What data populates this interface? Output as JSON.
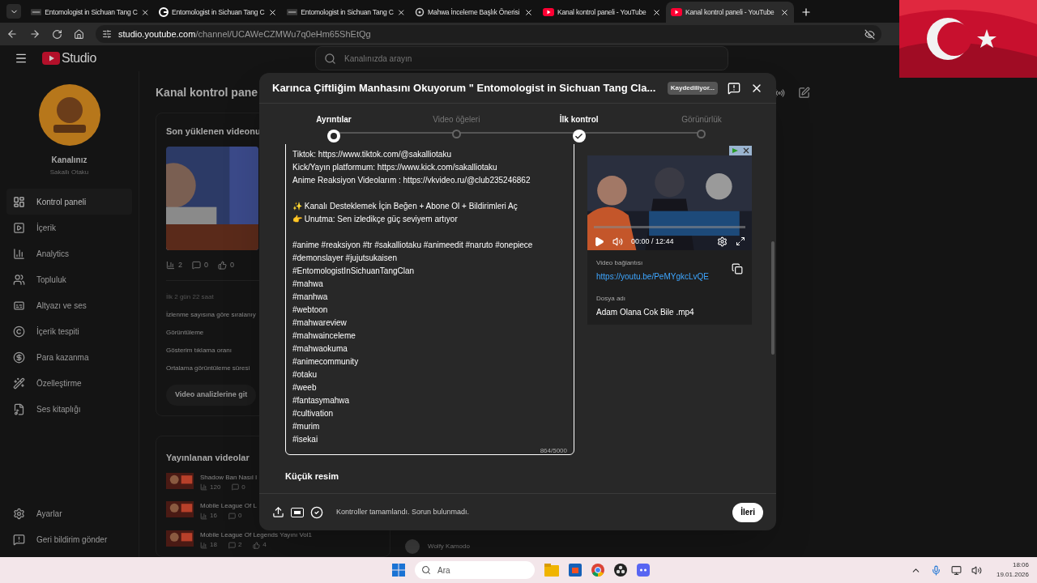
{
  "browser": {
    "tabs": [
      {
        "kind": "mgt",
        "title": "Entomologist in Sichuan Tang C",
        "selected": false
      },
      {
        "kind": "google",
        "title": "Entomologist in Sichuan Tang C",
        "selected": false
      },
      {
        "kind": "mgt",
        "title": "Entomologist in Sichuan Tang C",
        "selected": false
      },
      {
        "kind": "chat",
        "title": "Mahwa İnceleme Başlık Önerisi",
        "selected": false
      },
      {
        "kind": "youtube",
        "title": "Kanal kontrol paneli - YouTube",
        "selected": false
      },
      {
        "kind": "youtube",
        "title": "Kanal kontrol paneli - YouTube",
        "selected": true
      }
    ],
    "url_host": "studio.youtube.com",
    "url_path": "/channel/UCAWeCZMWu7q0eHm65ShEtQg"
  },
  "studio": {
    "logo": "Studio",
    "search_placeholder": "Kanalınızda arayın",
    "channel": {
      "label": "Kanalınız",
      "name": "Sakallı Otaku"
    },
    "nav": [
      {
        "kind": "dashboard",
        "label": "Kontrol paneli",
        "selected": true
      },
      {
        "kind": "content",
        "label": "İçerik",
        "selected": false
      },
      {
        "kind": "analytics",
        "label": "Analytics",
        "selected": false
      },
      {
        "kind": "community",
        "label": "Topluluk",
        "selected": false
      },
      {
        "kind": "subtitles",
        "label": "Altyazı ve ses",
        "selected": false
      },
      {
        "kind": "copyright",
        "label": "İçerik tespiti",
        "selected": false
      },
      {
        "kind": "earn",
        "label": "Para kazanma",
        "selected": false
      },
      {
        "kind": "customize",
        "label": "Özelleştirme",
        "selected": false
      },
      {
        "kind": "audio",
        "label": "Ses kitaplığı",
        "selected": false
      }
    ],
    "nav_bottom": [
      {
        "kind": "settings",
        "label": "Ayarlar",
        "selected": false
      },
      {
        "kind": "feedback",
        "label": "Geri bildirim gönder",
        "selected": false
      }
    ],
    "page_title": "Kanal kontrol pane",
    "latest": {
      "title": "Son yüklenen videonu",
      "stats": [
        "2",
        "0",
        "0"
      ],
      "period": "İlk 2 gün 22 saat",
      "rows": [
        "İzlenme sayısına göre sıralanıy",
        "Görüntüleme",
        "Gösterim tıklama oranı",
        "Ortalama görüntüleme süresi"
      ],
      "button": "Video analizlerine git"
    },
    "published": {
      "title": "Yayınlanan videolar",
      "videos": [
        {
          "title": "Shadow Ban Nasıl I",
          "views": "120",
          "comments": "0"
        },
        {
          "title": "Mobile League Of L",
          "views": "16",
          "comments": "0"
        },
        {
          "title": "Mobile League Of Legends Yayını Vol1",
          "views": "18",
          "comments": "2",
          "likes": "4"
        }
      ]
    },
    "comment_author": "Wolfy Kamodo"
  },
  "dialog": {
    "title": "Karınca Çiftliğim Manhasını Okuyorum \" Entomologist in Sichuan Tang Cla...",
    "saving": "Kaydediliyor...",
    "steps": [
      {
        "label": "Ayrıntılar",
        "kind": "current"
      },
      {
        "label": "Video öğeleri",
        "kind": "pending"
      },
      {
        "label": "İlk kontrol",
        "kind": "done"
      },
      {
        "label": "Görünürlük",
        "kind": "pending"
      }
    ],
    "description": [
      [
        "Tiktok: https://www.tiktok.com/@sakalliotaku",
        "Kick/Yayın platformum: https://www.kick.com/sakalliotaku",
        "Anime Reaksiyon Videolarım : https://vkvideo.ru/@club235246862"
      ],
      [
        "✨ Kanalı Desteklemek İçin Beğen + Abone Ol + Bildirimleri Aç",
        "👉 Unutma: Sen izledikçe güç seviyem artıyor"
      ],
      [
        "#anime #reaksiyon #tr #sakalliotaku #animeedit #naruto #onepiece",
        "#demonslayer #jujutsukaisen",
        "#EntomologistInSichuanTangClan",
        "#mahwa",
        "#manhwa",
        "#webtoon",
        "#mahwareview",
        "#mahwainceleme",
        "#mahwaokuma",
        "#animecommunity",
        "#otaku",
        "#weeb",
        "#fantasymahwa",
        "#cultivation",
        "#murim",
        "#isekai"
      ]
    ],
    "counter": "864/5000",
    "thumbnail_heading": "Küçük resim",
    "video": {
      "time": "00:00 / 12:44",
      "link_label": "Video bağlantısı",
      "link": "https://youtu.be/PeMYgkcLvQE",
      "file_label": "Dosya adı",
      "file": "Adam Olana Cok Bile .mp4"
    },
    "status": "Kontroller tamamlandı. Sorun bulunmadı.",
    "next": "İleri"
  },
  "taskbar": {
    "search_placeholder": "Ara",
    "time": "18:06",
    "date": "19.01.2026"
  }
}
